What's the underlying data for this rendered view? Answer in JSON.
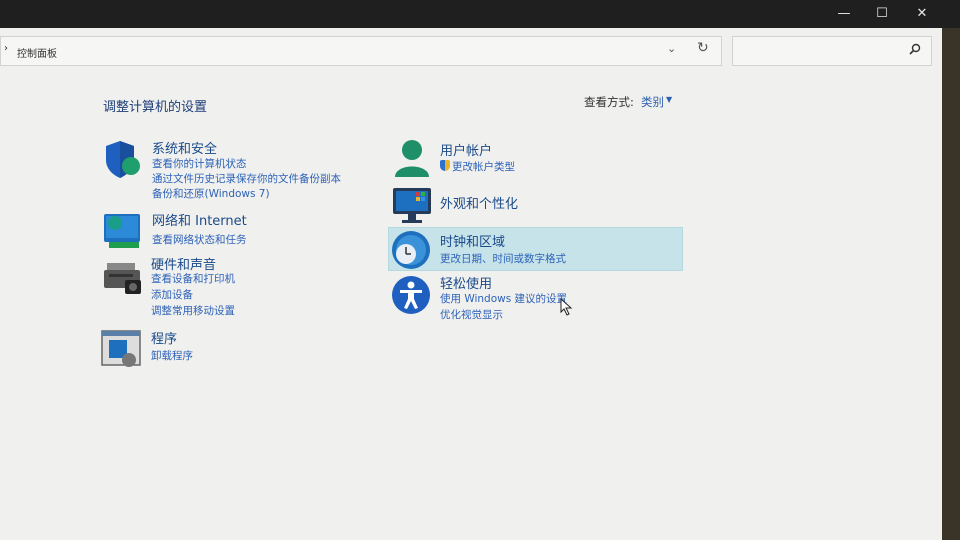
{
  "window": {
    "controls": {
      "minimize": "—",
      "maximize": "☐",
      "close": "✕"
    }
  },
  "address": {
    "breadcrumb": "控制面板",
    "chevron": "›",
    "dropdown": "⌄",
    "refresh": "↻"
  },
  "search": {
    "placeholder": "",
    "icon": "search-icon"
  },
  "page": {
    "title": "调整计算机的设置",
    "view_by_label": "查看方式:",
    "view_by_value": "类别"
  },
  "categories_left": [
    {
      "title": "系统和安全",
      "icon": "shield-icon",
      "links": [
        "查看你的计算机状态",
        "通过文件历史记录保存你的文件备份副本",
        "备份和还原(Windows 7)"
      ]
    },
    {
      "title": "网络和 Internet",
      "icon": "network-icon",
      "links": [
        "查看网络状态和任务"
      ]
    },
    {
      "title": "硬件和声音",
      "icon": "printer-icon",
      "links": [
        "查看设备和打印机",
        "添加设备",
        "调整常用移动设置"
      ]
    },
    {
      "title": "程序",
      "icon": "programs-icon",
      "links": [
        "卸载程序"
      ]
    }
  ],
  "categories_right": [
    {
      "title": "用户帐户",
      "icon": "user-icon",
      "links": [
        "更改帐户类型"
      ]
    },
    {
      "title": "外观和个性化",
      "icon": "monitor-icon",
      "links": []
    },
    {
      "title": "时钟和区域",
      "icon": "clock-icon",
      "links": [
        "更改日期、时间或数字格式"
      ]
    },
    {
      "title": "轻松使用",
      "icon": "accessibility-icon",
      "links": [
        "使用 Windows 建议的设置",
        "优化视觉显示"
      ]
    }
  ],
  "colors": {
    "link": "#2d62b8",
    "title": "#1a4a8a",
    "hover": "#c6e3ea"
  }
}
